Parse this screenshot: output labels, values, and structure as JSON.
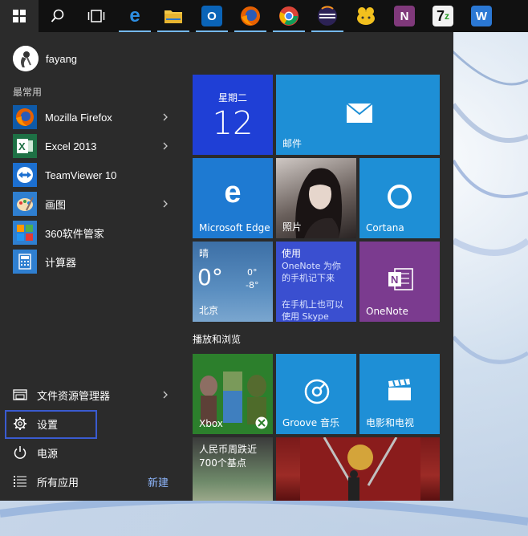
{
  "taskbar": {
    "items": [
      {
        "name": "start-button",
        "icon": "windows-logo-icon"
      },
      {
        "name": "search-button",
        "icon": "search-icon"
      },
      {
        "name": "task-view-button",
        "icon": "task-view-icon"
      },
      {
        "name": "edge",
        "icon": "edge-icon"
      },
      {
        "name": "file-explorer",
        "icon": "folder-icon"
      },
      {
        "name": "outlook",
        "icon": "outlook-icon"
      },
      {
        "name": "firefox",
        "icon": "firefox-icon"
      },
      {
        "name": "chrome",
        "icon": "chrome-icon"
      },
      {
        "name": "eclipse",
        "icon": "eclipse-icon"
      },
      {
        "name": "app-yellow",
        "icon": "yellow-app-icon"
      },
      {
        "name": "onenote",
        "icon": "onenote-icon"
      },
      {
        "name": "7zip",
        "icon": "7zip-icon"
      },
      {
        "name": "word",
        "icon": "word-icon"
      }
    ]
  },
  "user": {
    "name": "fayang"
  },
  "most_used_label": "最常用",
  "apps": [
    {
      "label": "Mozilla Firefox",
      "has_submenu": true
    },
    {
      "label": "Excel 2013",
      "has_submenu": true
    },
    {
      "label": "TeamViewer 10",
      "has_submenu": false
    },
    {
      "label": "画图",
      "has_submenu": true
    },
    {
      "label": "360软件管家",
      "has_submenu": false
    },
    {
      "label": "计算器",
      "has_submenu": false
    }
  ],
  "bottom": {
    "file_explorer": "文件资源管理器",
    "settings": "设置",
    "power": "电源",
    "all_apps": "所有应用",
    "new": "新建"
  },
  "tiles": {
    "calendar": {
      "weekday": "星期二",
      "day": "12"
    },
    "mail": {
      "label": "邮件"
    },
    "edge": {
      "label": "Microsoft Edge"
    },
    "photos": {
      "label": "照片"
    },
    "cortana": {
      "label": "Cortana"
    },
    "weather": {
      "condition": "晴",
      "temp": "0°",
      "high": "0°",
      "low": "-8°",
      "city": "北京"
    },
    "skype": {
      "title": "使用",
      "line1": "OneNote 为你",
      "line2": "的手机记下来",
      "line3": "在手机上也可以",
      "line4": "使用 Skype"
    },
    "onenote": {
      "label": "OneNote"
    },
    "group_title": "播放和浏览",
    "xbox": {
      "label": "Xbox"
    },
    "groove": {
      "label": "Groove 音乐"
    },
    "movies": {
      "label": "电影和电视"
    },
    "news": {
      "line1": "人民币周跌近",
      "line2": "700个基点"
    }
  },
  "colors": {
    "start_bg": "#2b2b2b",
    "tile_blue": "#1e8fd6",
    "tile_darkblue": "#1f3fd6",
    "tile_purple": "#7b3b8f",
    "selection_border": "#3a5bd0"
  }
}
